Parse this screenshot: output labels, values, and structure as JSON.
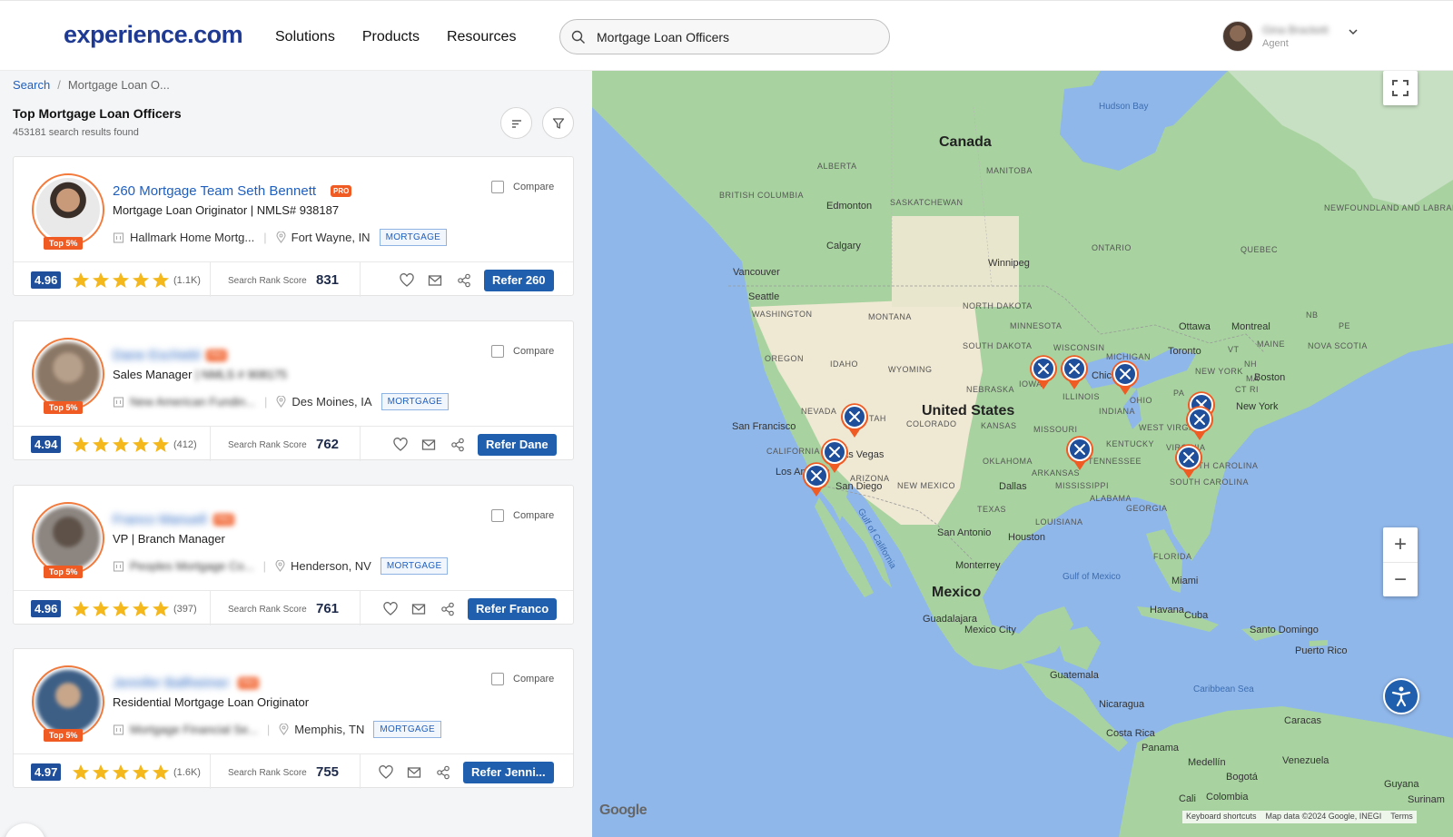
{
  "header": {
    "logo": "experience.com",
    "nav": [
      "Solutions",
      "Products",
      "Resources"
    ],
    "search_value": "Mortgage Loan Officers",
    "user_name": "Gina Brackett",
    "user_role": "Agent"
  },
  "breadcrumb": {
    "root": "Search",
    "current": "Mortgage Loan O..."
  },
  "page_title": "Top Mortgage Loan Officers",
  "result_count": "453181 search results found",
  "cards": [
    {
      "name": "260 Mortgage Team Seth Bennett",
      "pro": "PRO",
      "title": "Mortgage Loan Originator | NMLS# 938187",
      "title_suffix": "",
      "company": "Hallmark Home Mortg...",
      "location": "Fort Wayne, IN",
      "tag": "MORTGAGE",
      "top_badge": "Top 5%",
      "compare": "Compare",
      "score": "4.96",
      "rating": 5,
      "reviews": "(1.1K)",
      "rank_label": "Search Rank Score",
      "rank": "831",
      "refer": "Refer 260"
    },
    {
      "name": "Dane Eschiebl",
      "pro": "PRO",
      "title": "Sales Manager",
      "title_suffix": " | NMLS # 908175",
      "company": "New American Fundin...",
      "location": "Des Moines, IA",
      "tag": "MORTGAGE",
      "top_badge": "Top 5%",
      "compare": "Compare",
      "score": "4.94",
      "rating": 5,
      "reviews": "(412)",
      "rank_label": "Search Rank Score",
      "rank": "762",
      "refer": "Refer Dane"
    },
    {
      "name": "Franco Manuell",
      "pro": "PRO",
      "title": "VP | Branch Manager",
      "title_suffix": "",
      "company": "Peoples Mortgage Co...",
      "location": "Henderson, NV",
      "tag": "MORTGAGE",
      "top_badge": "Top 5%",
      "compare": "Compare",
      "score": "4.96",
      "rating": 5,
      "reviews": "(397)",
      "rank_label": "Search Rank Score",
      "rank": "761",
      "refer": "Refer Franco"
    },
    {
      "name": "Jennifer Ballheimer",
      "pro": "PRO",
      "title": "Residential Mortgage Loan Originator",
      "title_suffix": "",
      "company": "Mortgage Financial Se...",
      "location": "Memphis, TN",
      "tag": "MORTGAGE",
      "top_badge": "Top 5%",
      "compare": "Compare",
      "score": "4.97",
      "rating": 5,
      "reviews": "(1.6K)",
      "rank_label": "Search Rank Score",
      "rank": "755",
      "refer": "Refer Jenni..."
    }
  ],
  "map": {
    "countries": [
      "Canada",
      "United States",
      "Mexico",
      "Cuba",
      "Guatemala",
      "Nicaragua",
      "Costa Rica",
      "Panama",
      "Venezuela",
      "Colombia",
      "Guyana",
      "Surinam",
      "Puerto Rico",
      "Santo Domingo"
    ],
    "cities": [
      "Edmonton",
      "Calgary",
      "Vancouver",
      "Seattle",
      "Winnipeg",
      "Ottawa",
      "Montreal",
      "Toronto",
      "Boston",
      "New York",
      "Chicago",
      "San Francisco",
      "Las Vegas",
      "Los Angeles",
      "San Diego",
      "Dallas",
      "San Antonio",
      "Houston",
      "Monterrey",
      "Guadalajara",
      "Mexico City",
      "Havana",
      "Miami",
      "Caracas",
      "Medellín",
      "Bogotá",
      "Cali"
    ],
    "states": [
      "BRITISH COLUMBIA",
      "ALBERTA",
      "SASKATCHEWAN",
      "MANITOBA",
      "ONTARIO",
      "QUEBEC",
      "NEWFOUNDLAND AND LABRADOR",
      "NB",
      "PE",
      "NOVA SCOTIA",
      "WASHINGTON",
      "OREGON",
      "MONTANA",
      "IDAHO",
      "WYOMING",
      "NEVADA",
      "CALIFORNIA",
      "NORTH DAKOTA",
      "SOUTH DAKOTA",
      "NEBRASKA",
      "COLORADO",
      "KANSAS",
      "NEW MEXICO",
      "ARIZONA",
      "TEXAS",
      "OKLAHOMA",
      "MISSOURI",
      "ARKANSAS",
      "LOUISIANA",
      "MISSISSIPPI",
      "ALABAMA",
      "GEORGIA",
      "FLORIDA",
      "TENNESSEE",
      "KENTUCKY",
      "ILLINOIS",
      "INDIANA",
      "OHIO",
      "MICHIGAN",
      "WISCONSIN",
      "MINNESOTA",
      "IOWA",
      "NEW YORK",
      "PA",
      "MAINE",
      "VT",
      "NH",
      "MA",
      "CT",
      "RI",
      "WEST VIRGINIA",
      "VIRGINIA",
      "NORTH CAROLINA",
      "SOUTH CAROLINA",
      "UTAH"
    ],
    "water": [
      "Hudson Bay",
      "Gulf of Mexico",
      "Caribbean Sea",
      "Gulf of California"
    ],
    "attribution": [
      "Keyboard shortcuts",
      "Map data ©2024 Google, INEGI",
      "Terms"
    ],
    "google": "Google"
  }
}
